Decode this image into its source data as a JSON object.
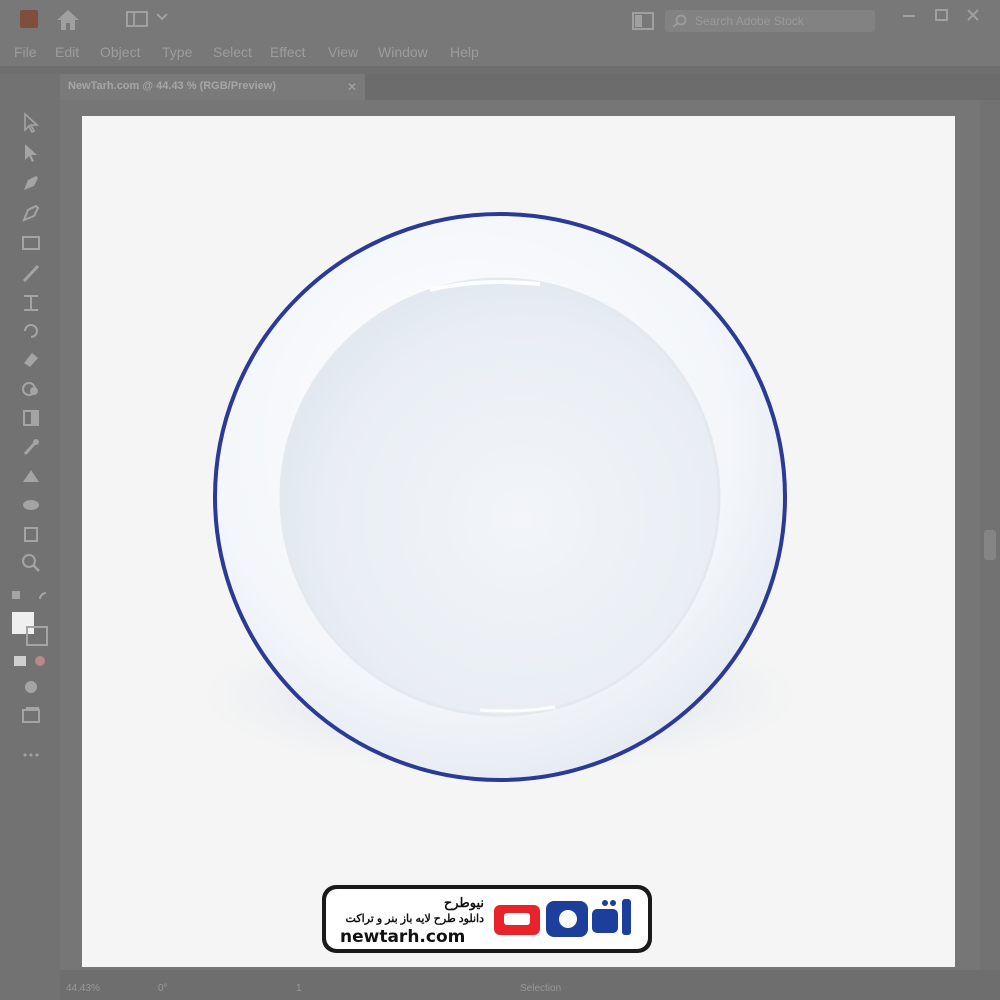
{
  "app": {
    "title_icon": "illustrator-app-icon",
    "search_placeholder": "Search Adobe Stock"
  },
  "menu": {
    "items": [
      "File",
      "Edit",
      "Object",
      "Type",
      "Select",
      "Effect",
      "View",
      "Window",
      "Help"
    ]
  },
  "document": {
    "tab_title": "NewTarh.com @ 44.43 % (RGB/Preview)",
    "close_label": "✕"
  },
  "status": {
    "zoom": "44.43%",
    "rotation": "0°",
    "artboard": "1",
    "tool": "Selection"
  },
  "watermark": {
    "title": "نیوطرح",
    "subtitle": "دانلود طرح لایه باز بنر و تراکت",
    "url": "newtarh.com",
    "logo_text": "نیوطرح"
  },
  "colors": {
    "ui_gray": "#7a7a7a",
    "artboard": "#f5f5f5",
    "plate_rim": "#2a3a96",
    "logo_red": "#e8232a",
    "logo_blue": "#1c3f9c"
  }
}
